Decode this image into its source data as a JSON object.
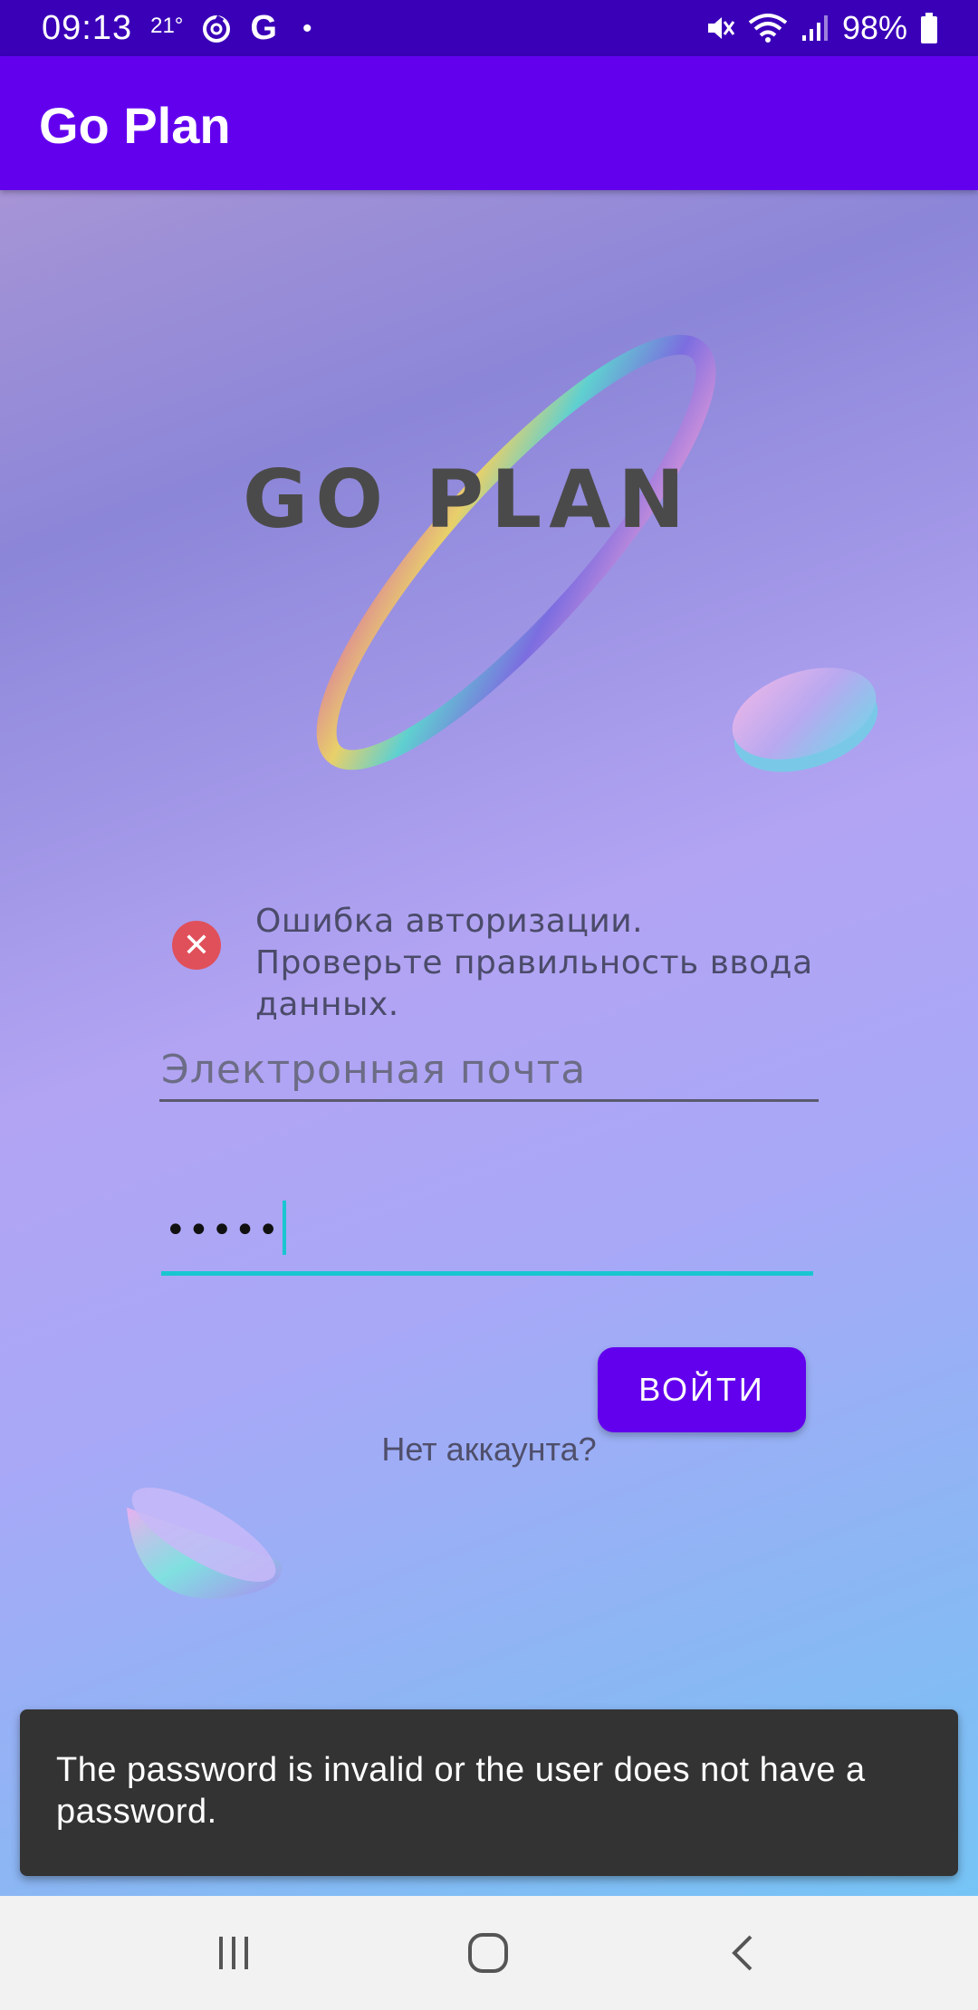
{
  "status_bar": {
    "time": "09:13",
    "temperature": "21°",
    "google": "G",
    "dot": "•",
    "battery": "98%",
    "icons": [
      "weather-icon",
      "sync-icon",
      "google-icon",
      "mute-icon",
      "wifi-icon",
      "signal-icon",
      "battery-icon"
    ]
  },
  "app_bar": {
    "title": "Go Plan"
  },
  "logo": {
    "text": "GO PLAN"
  },
  "error": {
    "icon": "error-icon",
    "message": "Ошибка авторизации. Проверьте правильность ввода данных."
  },
  "form": {
    "email": {
      "value": "",
      "placeholder": "Электронная почта"
    },
    "password": {
      "masked_value": "•••••"
    },
    "login_button": "ВОЙТИ",
    "no_account": "Нет аккаунта?"
  },
  "snackbar": {
    "message": "The password is invalid or the user does not have a password."
  },
  "nav_bar": {
    "buttons": [
      "recent-apps-icon",
      "home-icon",
      "back-icon"
    ]
  },
  "colors": {
    "status_bar": "#3a00b8",
    "app_bar": "#6200ee",
    "button": "#6200ee",
    "accent": "#19c6d0",
    "error": "#e0505a",
    "snackbar": "#333333"
  }
}
